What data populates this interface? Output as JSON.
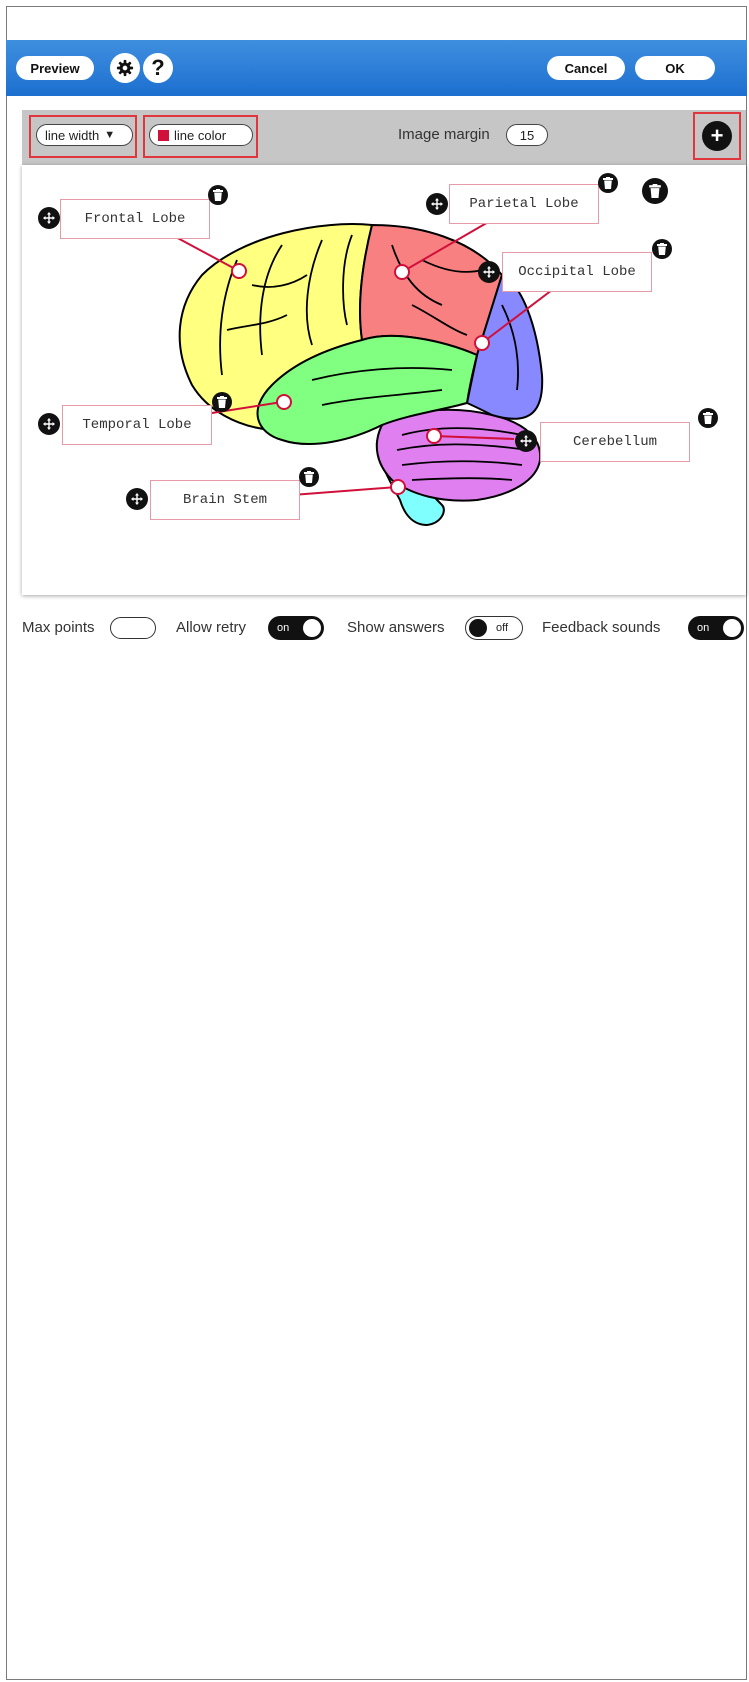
{
  "header": {
    "preview_label": "Preview",
    "help_label": "?",
    "cancel_label": "Cancel",
    "ok_label": "OK"
  },
  "toolbar": {
    "line_width_label": "line width",
    "line_color_label": "line color",
    "line_color_value": "#d0103a",
    "image_margin_label": "Image margin",
    "image_margin_value": "15",
    "add_label": "+"
  },
  "labels": [
    {
      "text": "Frontal Lobe"
    },
    {
      "text": "Parietal Lobe"
    },
    {
      "text": "Occipital Lobe"
    },
    {
      "text": "Temporal Lobe"
    },
    {
      "text": "Cerebellum"
    },
    {
      "text": "Brain Stem"
    }
  ],
  "settings": {
    "max_points_label": "Max points",
    "max_points_value": "",
    "allow_retry_label": "Allow retry",
    "allow_retry_state": "on",
    "show_answers_label": "Show answers",
    "show_answers_state": "off",
    "feedback_sounds_label": "Feedback sounds",
    "feedback_sounds_state": "on"
  },
  "colors": {
    "header_blue": "#1c6fcf",
    "accent_red": "#d0103a",
    "frontal": "#ffff80",
    "parietal": "#f98080",
    "occipital": "#8888ff",
    "temporal": "#80ff80",
    "cerebellum": "#e080f0",
    "brainstem": "#80ffff"
  },
  "icons": [
    "gear-icon",
    "help-icon",
    "plus-icon",
    "move-icon",
    "trash-icon",
    "dropdown-arrow-icon"
  ]
}
